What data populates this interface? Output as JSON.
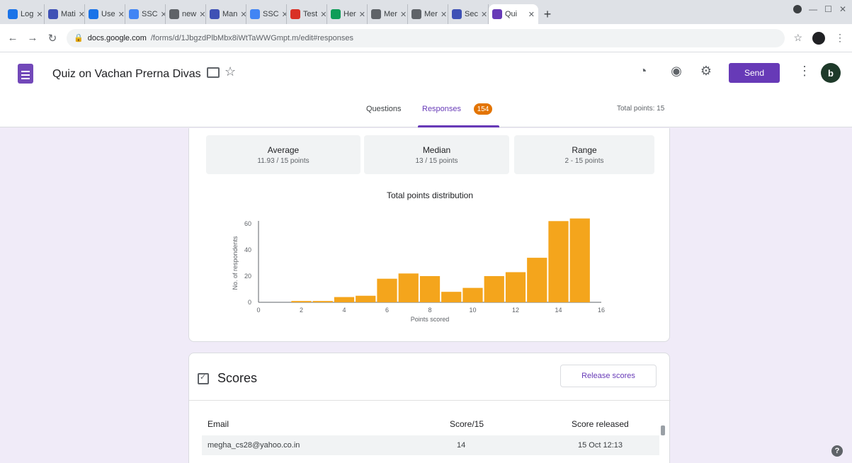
{
  "browser": {
    "tabs": [
      {
        "label": "Log",
        "color": "#1a73e8"
      },
      {
        "label": "Mati",
        "color": "#3f51b5"
      },
      {
        "label": "Use",
        "color": "#1a73e8"
      },
      {
        "label": "SSC",
        "color": "#4285f4"
      },
      {
        "label": "new",
        "color": "#5f6368"
      },
      {
        "label": "Man",
        "color": "#3f51b5"
      },
      {
        "label": "SSC",
        "color": "#4285f4"
      },
      {
        "label": "Test",
        "color": "#d93025"
      },
      {
        "label": "Her",
        "color": "#0f9d58"
      },
      {
        "label": "Mer",
        "color": "#5f6368"
      },
      {
        "label": "Mer",
        "color": "#5f6368"
      },
      {
        "label": "Sec",
        "color": "#3f51b5"
      }
    ],
    "active_tab": {
      "label": "Qui",
      "color": "#673ab7"
    },
    "new_tab_label": "+",
    "url_host": "docs.google.com",
    "url_path": "/forms/d/1JbgzdPlbMbx8iWtTaWWGmpt.m/edit#responses",
    "win_min": "—",
    "win_max": "☐",
    "win_close": "✕"
  },
  "form": {
    "title": "Quiz on Vachan Prerna Divas",
    "send_label": "Send",
    "avatar_letter": "b",
    "tabs": {
      "questions": "Questions",
      "responses": "Responses",
      "responses_count": "154"
    },
    "total_points": "Total points: 15",
    "accent": "#673ab7"
  },
  "summary": {
    "stats": [
      {
        "label": "Average",
        "value": "11.93 / 15 points"
      },
      {
        "label": "Median",
        "value": "13 / 15 points"
      },
      {
        "label": "Range",
        "value": "2 - 15 points"
      }
    ],
    "distribution_title": "Total points distribution"
  },
  "chart_data": {
    "type": "bar",
    "xlabel": "Points scored",
    "ylabel": "No. of respondents",
    "xlim": [
      0,
      16
    ],
    "ylim": [
      0,
      60
    ],
    "xticks": [
      0,
      2,
      4,
      6,
      8,
      10,
      12,
      14,
      16
    ],
    "yticks": [
      0,
      20,
      40,
      60
    ],
    "x": [
      2,
      3,
      4,
      5,
      6,
      7,
      8,
      9,
      10,
      11,
      12,
      13,
      14,
      15
    ],
    "values": [
      1,
      1,
      4,
      5,
      18,
      22,
      20,
      8,
      11,
      20,
      23,
      34,
      62,
      64
    ],
    "bar_color": "#f4a51c"
  },
  "scores": {
    "title": "Scores",
    "release_label": "Release scores",
    "columns": [
      "Email",
      "Score/15",
      "Score released"
    ],
    "rows": [
      {
        "email": "megha_cs28@yahoo.co.in",
        "score": "14",
        "released": "15 Oct 12:13"
      }
    ]
  }
}
